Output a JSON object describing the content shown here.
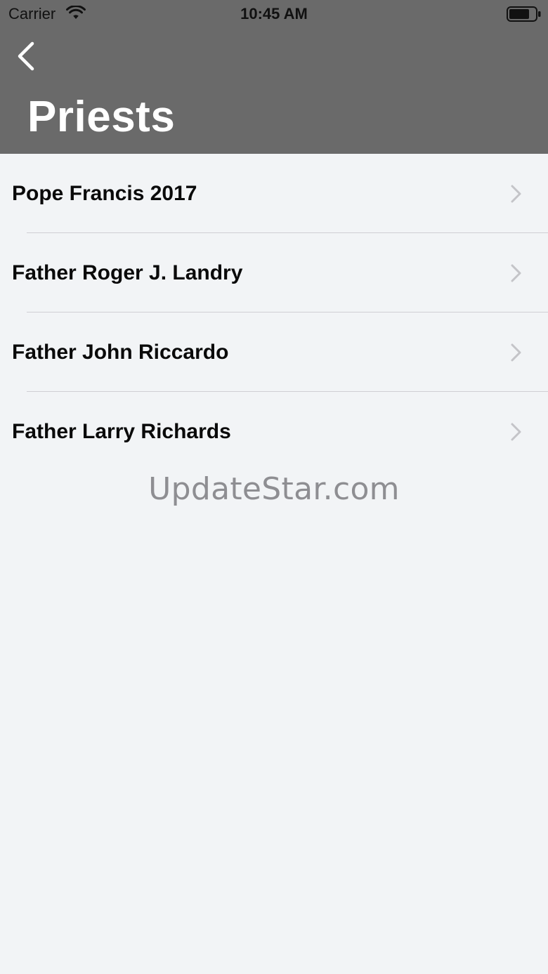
{
  "status_bar": {
    "carrier": "Carrier",
    "time": "10:45 AM",
    "wifi_icon": "wifi-icon",
    "battery_icon": "battery-icon"
  },
  "nav": {
    "back_icon": "chevron-left-icon",
    "title": "Priests",
    "background_color": "#6a6a6a"
  },
  "list": {
    "items": [
      {
        "label": "Pope Francis 2017"
      },
      {
        "label": "Father Roger J. Landry"
      },
      {
        "label": "Father John Riccardo"
      },
      {
        "label": "Father Larry Richards"
      }
    ],
    "disclosure_icon": "chevron-right-icon"
  },
  "watermark": "UpdateStar.com"
}
